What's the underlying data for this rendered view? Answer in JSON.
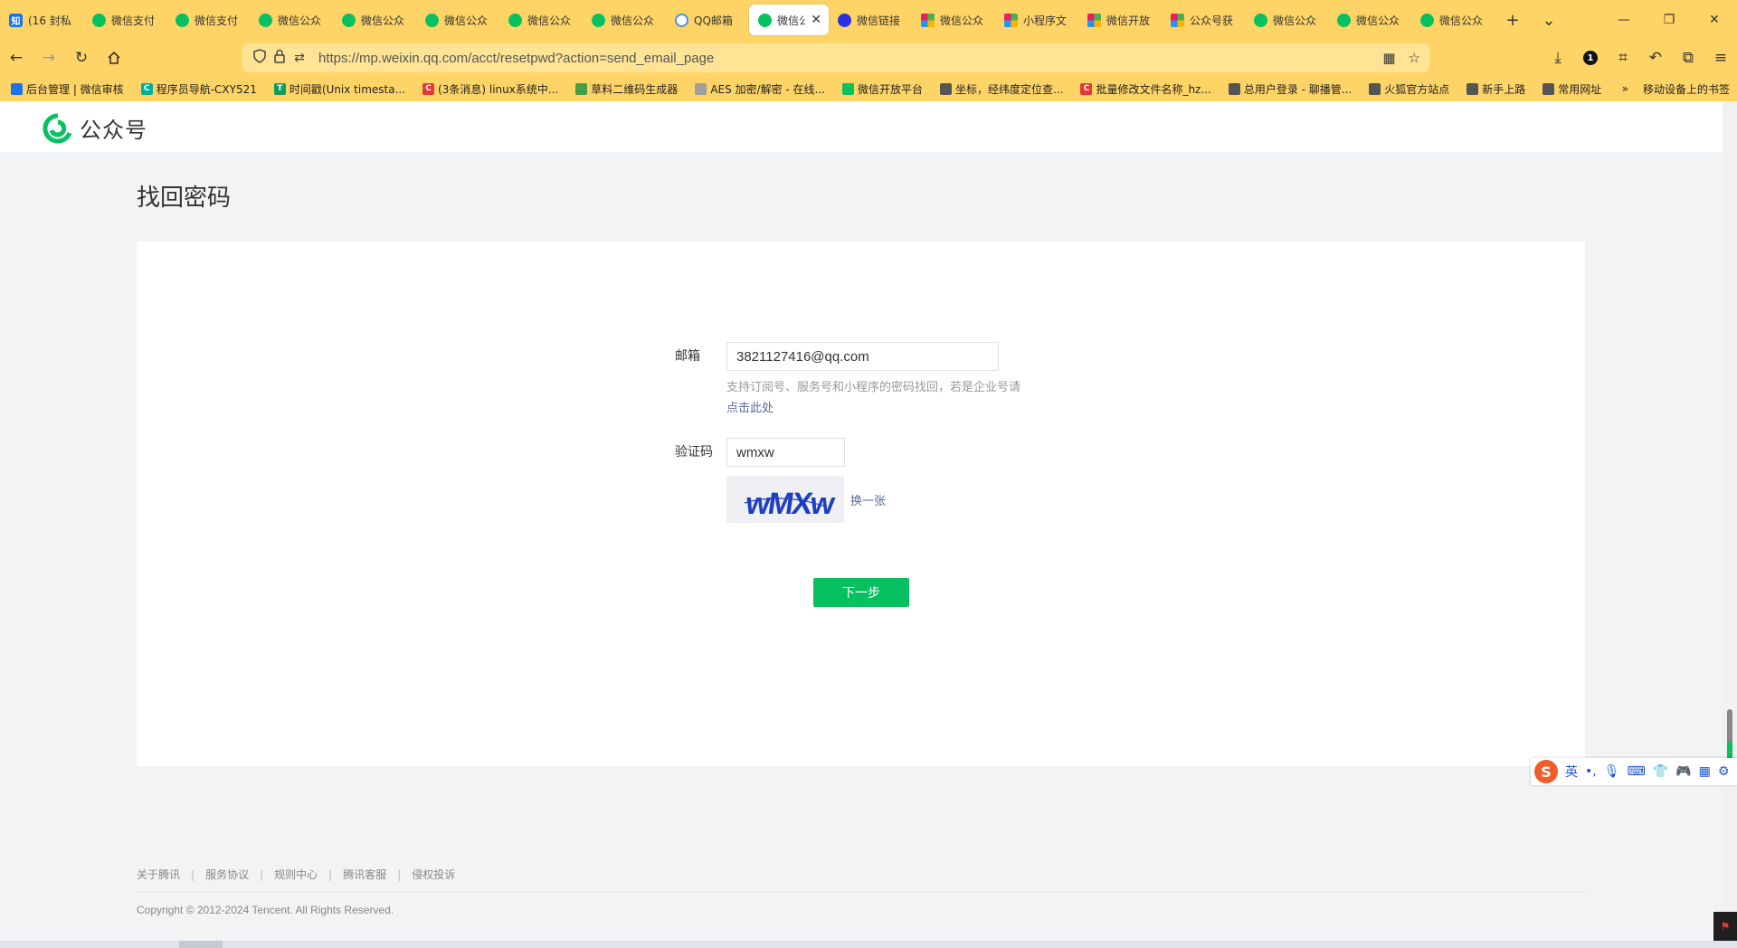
{
  "browser": {
    "tabs": [
      {
        "label": "(16 封私",
        "icon": "zhihu-icon",
        "icon_text": "知"
      },
      {
        "label": "微信支付",
        "icon": "wechat-icon"
      },
      {
        "label": "微信支付",
        "icon": "wechat-icon"
      },
      {
        "label": "微信公众",
        "icon": "wechat-icon"
      },
      {
        "label": "微信公众",
        "icon": "wechat-icon"
      },
      {
        "label": "微信公众",
        "icon": "wechat-icon"
      },
      {
        "label": "微信公众",
        "icon": "wechat-icon"
      },
      {
        "label": "微信公众",
        "icon": "wechat-icon"
      },
      {
        "label": "QQ邮箱",
        "icon": "qqmail-icon"
      },
      {
        "label": "微信公",
        "icon": "wechat-icon",
        "active": true
      },
      {
        "label": "微信链接",
        "icon": "baidu-icon"
      },
      {
        "label": "微信公众",
        "icon": "grid-icon"
      },
      {
        "label": "小程序文",
        "icon": "grid-icon"
      },
      {
        "label": "微信开放",
        "icon": "grid-icon"
      },
      {
        "label": "公众号获",
        "icon": "grid-icon"
      },
      {
        "label": "微信公众",
        "icon": "wechat-icon"
      },
      {
        "label": "微信公众",
        "icon": "wechat-icon"
      },
      {
        "label": "微信公众",
        "icon": "wechat-icon"
      }
    ],
    "url": "https://mp.weixin.qq.com/acct/resetpwd?action=send_email_page",
    "bookmarks": [
      {
        "label": "后台管理 | 微信审核",
        "color": "#1a73e8"
      },
      {
        "label": "程序员导航-CXY521",
        "color": "#00b09b",
        "letter": "C"
      },
      {
        "label": "时间戳(Unix timesta...",
        "color": "#0f9d58",
        "letter": "T"
      },
      {
        "label": "(3条消息) linux系统中...",
        "color": "#e53935",
        "letter": "C"
      },
      {
        "label": "草料二维码生成器",
        "color": "#43a047"
      },
      {
        "label": "AES 加密/解密 - 在线...",
        "color": "#9e9e9e"
      },
      {
        "label": "微信开放平台",
        "color": "#07c160"
      },
      {
        "label": "坐标，经纬度定位查...",
        "color": "#555555"
      },
      {
        "label": "批量修改文件名称_hz...",
        "color": "#e53935",
        "letter": "C"
      },
      {
        "label": "总用户登录 - 聊播管...",
        "color": "#555555"
      },
      {
        "label": "火狐官方站点",
        "color": "#555555"
      },
      {
        "label": "新手上路",
        "color": "#555555"
      },
      {
        "label": "常用网址",
        "color": "#555555"
      }
    ],
    "bookmarks_more": "»",
    "mobile_bookmarks": "移动设备上的书签"
  },
  "header": {
    "logo_text": "公众号"
  },
  "page": {
    "title": "找回密码",
    "email_label": "邮箱",
    "email_value": "3821127416@qq.com",
    "email_hint": "支持订阅号、服务号和小程序的密码找回，若是企业号请",
    "email_link": "点击此处",
    "captcha_label": "验证码",
    "captcha_value": "wmxw",
    "captcha_image_text": "wMXw",
    "refresh_captcha": "换一张",
    "next_button": "下一步"
  },
  "footer": {
    "links": [
      "关于腾讯",
      "服务协议",
      "规则中心",
      "腾讯客服",
      "侵权投诉"
    ],
    "copyright": "Copyright © 2012-2024 Tencent. All Rights Reserved."
  },
  "ime": {
    "mode": "英",
    "punct": "•,"
  },
  "colors": {
    "browser_chrome": "#ffd467",
    "primary_button": "#07c160",
    "link": "#576b95"
  }
}
